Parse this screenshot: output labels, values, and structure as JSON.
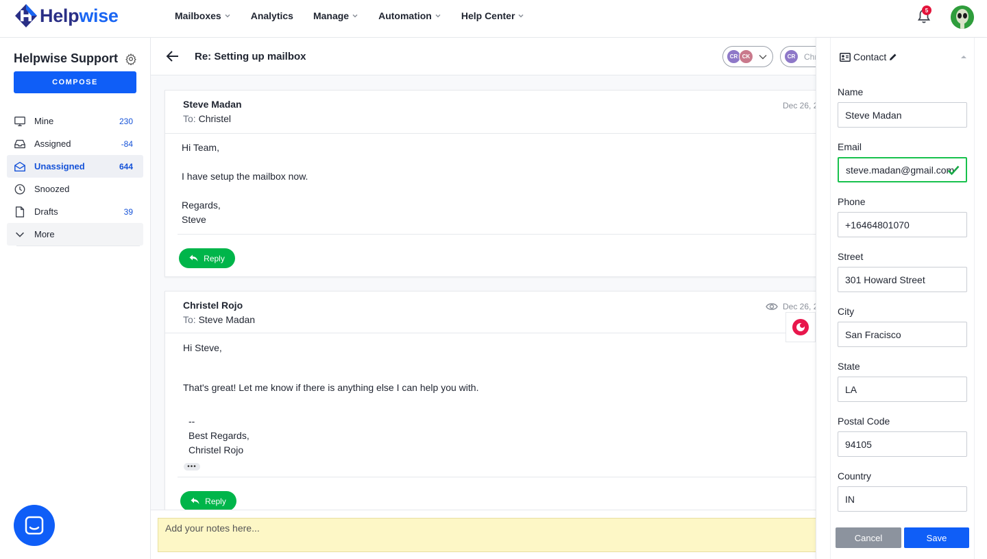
{
  "app": {
    "brand_help": "Help",
    "brand_wise": "wise",
    "notifications_count": "5"
  },
  "nav": {
    "items": [
      {
        "label": "Mailboxes",
        "dropdown": true
      },
      {
        "label": "Analytics",
        "dropdown": false
      },
      {
        "label": "Manage",
        "dropdown": true
      },
      {
        "label": "Automation",
        "dropdown": true
      },
      {
        "label": "Help Center",
        "dropdown": true
      }
    ]
  },
  "sidebar": {
    "mailbox_name": "Helpwise Support",
    "compose_label": "COMPOSE",
    "items": [
      {
        "label": "Mine",
        "count": "230",
        "icon": "monitor-icon"
      },
      {
        "label": "Assigned",
        "count": "-84",
        "icon": "inbox-icon"
      },
      {
        "label": "Unassigned",
        "count": "644",
        "icon": "envelope-icon"
      },
      {
        "label": "Snoozed",
        "count": "",
        "icon": "clock-icon"
      },
      {
        "label": "Drafts",
        "count": "39",
        "icon": "file-icon"
      },
      {
        "label": "More",
        "count": "",
        "icon": "chevron-down-icon"
      }
    ]
  },
  "thread": {
    "title": "Re: Setting up mailbox",
    "assignees": [
      "CR",
      "CK"
    ],
    "owner_initials": "CR",
    "owner_name": "Chr"
  },
  "messages": [
    {
      "from": "Steve Madan",
      "to_label": "To:",
      "to": "Christel",
      "date": "Dec 26, 2",
      "body": [
        "Hi Team,",
        "I have setup the mailbox now.",
        "Regards,",
        "Steve"
      ],
      "reply_label": "Reply"
    },
    {
      "from": "Christel Rojo",
      "to_label": "To:",
      "to": "Steve Madan",
      "date": "Dec 26, 2",
      "body": [
        "Hi Steve,",
        "That's great! Let me know if there is anything else I can help you with.",
        "--",
        "Best Regards,",
        "Christel Rojo"
      ],
      "reply_label": "Reply"
    }
  ],
  "notes": {
    "placeholder": "Add your notes here..."
  },
  "contact": {
    "title": "Contact",
    "fields": {
      "name": {
        "label": "Name",
        "value": "Steve Madan"
      },
      "email": {
        "label": "Email",
        "value": "steve.madan@gmail.com"
      },
      "phone": {
        "label": "Phone",
        "value": "+16464801070"
      },
      "street": {
        "label": "Street",
        "value": "301 Howard Street"
      },
      "city": {
        "label": "City",
        "value": "San Fracisco"
      },
      "state": {
        "label": "State",
        "value": "LA"
      },
      "postal": {
        "label": "Postal Code",
        "value": "94105"
      },
      "country": {
        "label": "Country",
        "value": "IN"
      }
    },
    "cancel_label": "Cancel",
    "save_label": "Save"
  },
  "colors": {
    "primary": "#0f5ef7",
    "reply_green": "#00b54a",
    "valid_green": "#17c14c",
    "notes_bg": "#fdf7c6",
    "badge_red": "#e3143b"
  }
}
